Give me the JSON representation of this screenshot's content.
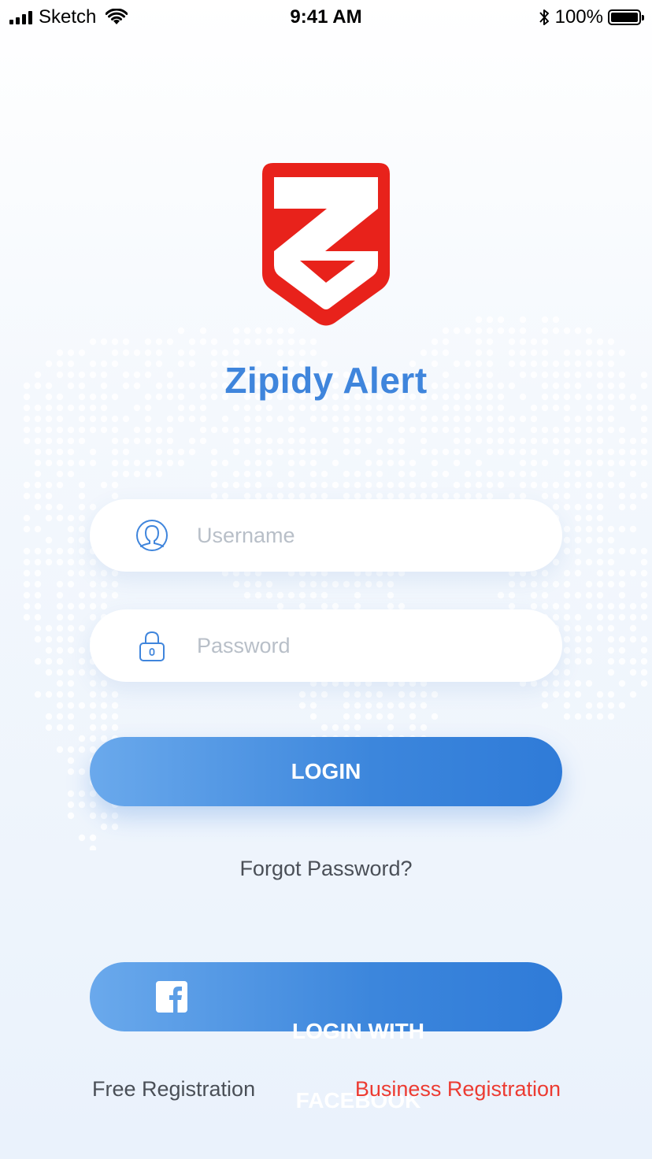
{
  "status_bar": {
    "carrier": "Sketch",
    "time": "9:41 AM",
    "battery": "100%"
  },
  "app": {
    "title": "Zipidy Alert",
    "logo_color": "#e8221b",
    "title_color": "#3f85dc"
  },
  "form": {
    "username_placeholder": "Username",
    "username_icon": "user-icon",
    "password_placeholder": "Password",
    "password_icon": "lock-icon",
    "login_label": "LOGIN",
    "forgot_label": "Forgot Password?"
  },
  "social": {
    "facebook_label": "LOGIN WITH FACEBOOK",
    "facebook_icon": "facebook-icon"
  },
  "registration": {
    "free_label": "Free Registration",
    "business_label": "Business Registration",
    "business_color": "#ec3b32"
  },
  "colors": {
    "button_gradient_start": "#6aa9ec",
    "button_gradient_end": "#2f7bd8",
    "accent": "#3f85dc"
  }
}
